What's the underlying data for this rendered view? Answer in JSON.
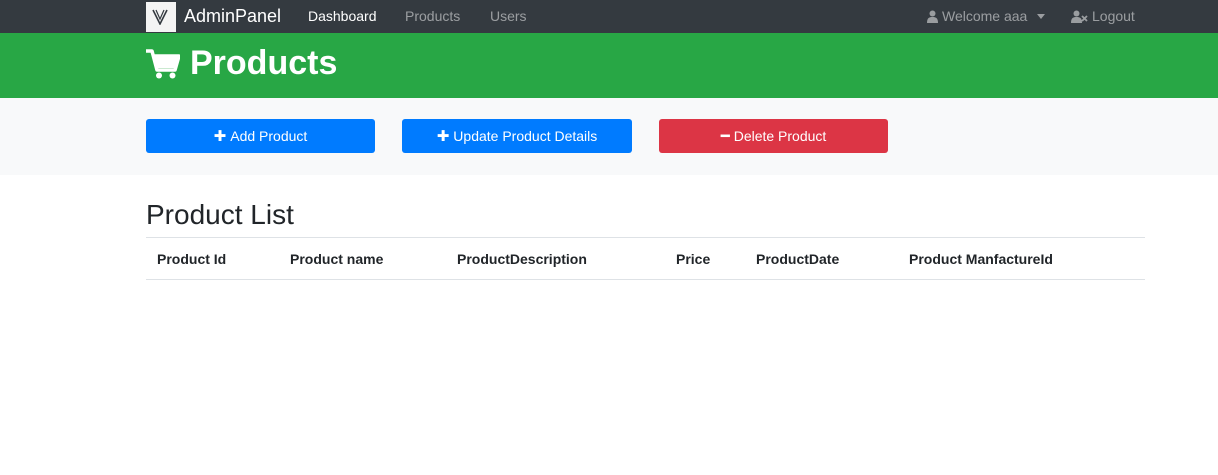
{
  "navbar": {
    "brand": "AdminPanel",
    "links": [
      "Dashboard",
      "Products",
      "Users"
    ],
    "user_menu": "Welcome aaa",
    "logout": "Logout"
  },
  "header": {
    "title": "Products"
  },
  "actions": {
    "add": "Add Product",
    "update": "Update Product Details",
    "delete": "Delete Product"
  },
  "product_list": {
    "title": "Product List",
    "columns": [
      "Product Id",
      "Product name",
      "ProductDescription",
      "Price",
      "ProductDate",
      "Product ManfactureId"
    ],
    "rows": []
  },
  "colors": {
    "navbar": "#343a40",
    "header": "#28a745",
    "primary": "#007bff",
    "danger": "#dc3545"
  }
}
